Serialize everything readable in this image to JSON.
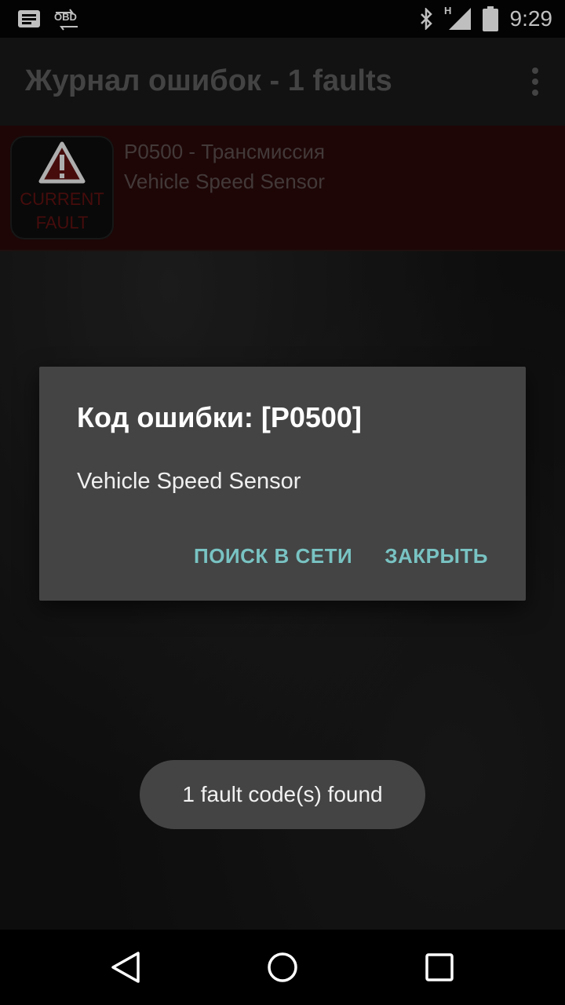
{
  "status_bar": {
    "time": "9:29",
    "obd_label": "OBD",
    "network_label": "H",
    "icons": [
      "notification-icon",
      "obd-sync-icon",
      "bluetooth-icon",
      "signal-icon",
      "battery-icon"
    ]
  },
  "app_bar": {
    "title": "Журнал ошибок - 1 faults",
    "menu_icon": "overflow-menu-icon"
  },
  "fault_list": {
    "items": [
      {
        "badge_line1": "CURRENT",
        "badge_line2": "FAULT",
        "code_line": "P0500 - Трансмиссия",
        "description": "Vehicle Speed Sensor"
      }
    ]
  },
  "dialog": {
    "title": "Код ошибки: [P0500]",
    "message": "Vehicle Speed Sensor",
    "search_button": "ПОИСК В СЕТИ",
    "close_button": "ЗАКРЫТЬ"
  },
  "toast": {
    "text": "1 fault code(s) found"
  },
  "nav_bar": {
    "icons": [
      "back-icon",
      "home-icon",
      "recents-icon"
    ]
  },
  "colors": {
    "accent": "#79c3c3",
    "fault_row_bg": "#280808",
    "dialog_bg": "#444444",
    "badge_red": "#5e1111"
  }
}
